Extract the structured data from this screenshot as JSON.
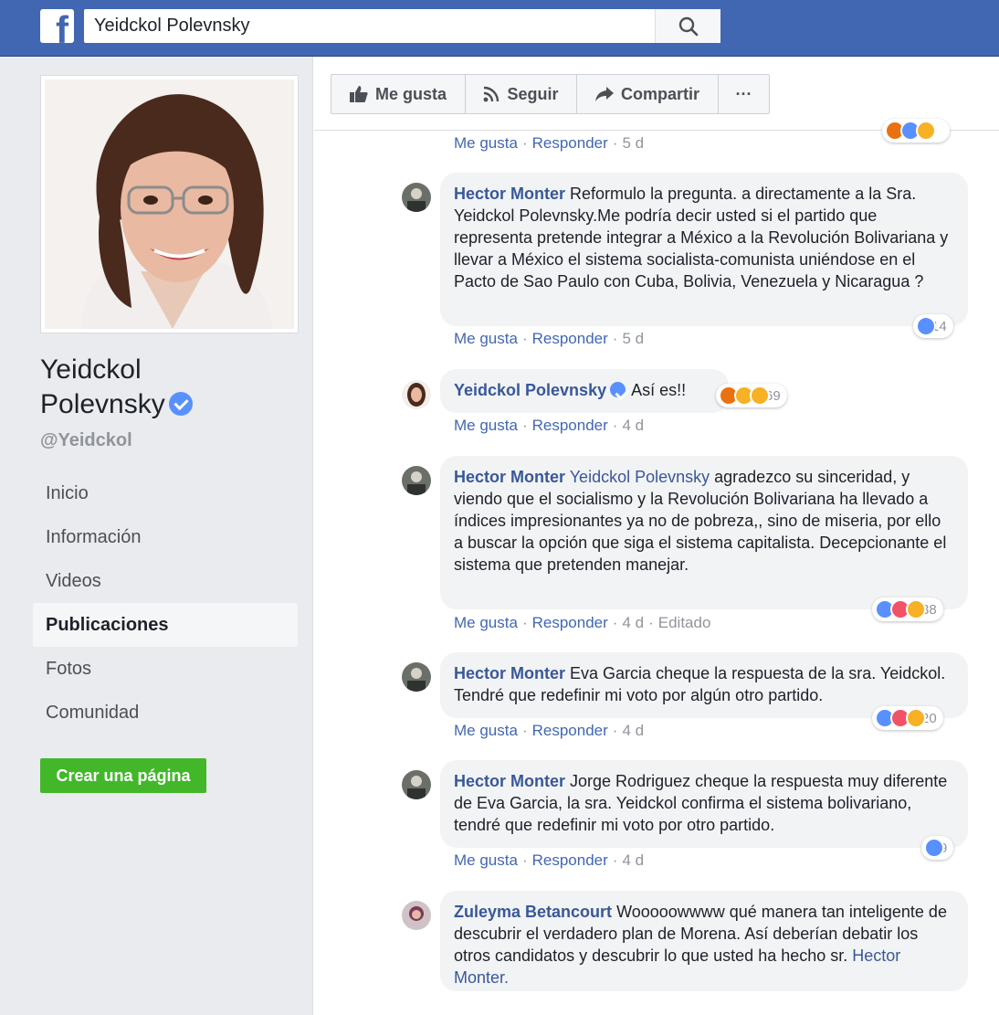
{
  "header": {
    "logo": "f",
    "search_value": "Yeidckol Polevnsky",
    "search_icon": "search-icon"
  },
  "sidebar": {
    "name_line1": "Yeidckol",
    "name_line2": "Polevnsky",
    "handle": "@Yeidckol",
    "nav": [
      {
        "label": "Inicio",
        "active": false
      },
      {
        "label": "Información",
        "active": false
      },
      {
        "label": "Videos",
        "active": false
      },
      {
        "label": "Publicaciones",
        "active": true
      },
      {
        "label": "Fotos",
        "active": false
      },
      {
        "label": "Comunidad",
        "active": false
      }
    ],
    "create_page": "Crear una página"
  },
  "actions": {
    "like": "Me gusta",
    "follow": "Seguir",
    "share": "Compartir",
    "more": "···"
  },
  "labels": {
    "like": "Me gusta",
    "reply": "Responder",
    "edited": "Editado",
    "sep": "·"
  },
  "comments": [
    {
      "meta_only": true,
      "time": "5 d"
    },
    {
      "author": "Hector Monter",
      "text": "Reformulo la pregunta. a directamente a la Sra. Yeidckol Polevnsky.Me podría decir usted si el partido que representa pretende integrar a México a la Revolución Bolivariana y llevar a México el sistema socialista-comunista uniéndose en el Pacto de Sao Paulo con Cuba, Bolivia, Venezuela y Nicaragua ?",
      "time": "5 d",
      "reaction_count": "14"
    },
    {
      "author": "Yeidckol Polevnsky",
      "text": "Así es!!",
      "time": "4 d",
      "reaction_count": "69"
    },
    {
      "author": "Hector Monter",
      "mention": "Yeidckol Polevnsky",
      "text": "agradezco su sinceridad, y viendo que el socialismo y la Revolución Bolivariana ha llevado a índices impresionantes ya no de pobreza,, sino de miseria, por ello a buscar la opción que siga el sistema capitalista. Decepcionante el sistema que pretenden manejar.",
      "time": "4 d",
      "reaction_count": "38"
    },
    {
      "author": "Hector Monter",
      "text": "Eva Garcia cheque la respuesta de la sra. Yeidckol. Tendré que redefinir mi voto por algún otro partido.",
      "time": "4 d",
      "reaction_count": "20"
    },
    {
      "author": "Hector Monter",
      "text": "Jorge Rodriguez cheque la respuesta muy diferente de Eva Garcia, la sra. Yeidckol confirma el sistema bolivariano, tendré que redefinir mi voto por otro partido.",
      "time": "4 d",
      "reaction_count": "9"
    },
    {
      "author": "Zuleyma Betancourt",
      "text": "Wooooowwww qué manera tan inteligente de descubrir el verdadero plan de Morena. Así deberían debatir los otros candidatos y descubrir lo que usted ha hecho sr.",
      "mention_end": "Hector Monter."
    }
  ],
  "colors": {
    "topbar": "#4267b2",
    "link": "#385898",
    "green": "#42b72a",
    "like_blue": "#5890ff"
  }
}
